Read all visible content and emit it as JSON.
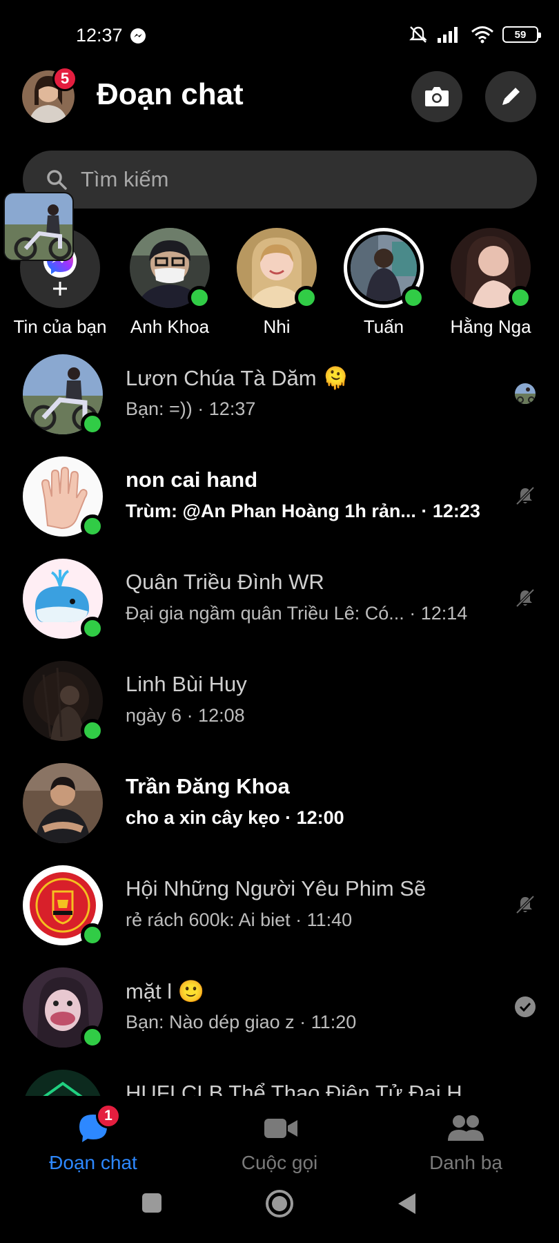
{
  "status_bar": {
    "time": "12:37",
    "battery": "59"
  },
  "header": {
    "title": "Đoạn chat",
    "profile_badge": "5"
  },
  "search": {
    "placeholder": "Tìm kiếm"
  },
  "stories": [
    {
      "label": "Tin của bạn"
    },
    {
      "label": "Anh Khoa"
    },
    {
      "label": "Nhi"
    },
    {
      "label": "Tuấn"
    },
    {
      "label": "Hằng Nga"
    }
  ],
  "chats": [
    {
      "name": "Lươn Chúa Tà Dăm 🫠",
      "preview": "Bạn: =)) · 12:37",
      "status": "seen-avatar"
    },
    {
      "name": "non cai hand",
      "preview": "Trùm: @An Phan Hoàng 1h rản...  · 12:23",
      "status": "muted"
    },
    {
      "name": "Quân Triều Đình WR",
      "preview": "Đại gia ngầm quân Triều Lê: Có...  · 12:14",
      "status": "muted"
    },
    {
      "name": "Linh Bùi Huy",
      "preview": "ngày 6 · 12:08",
      "status": "none"
    },
    {
      "name": "Trần Đăng Khoa",
      "preview": "cho a xin cây kẹo · 12:00",
      "status": "none"
    },
    {
      "name": "Hội Những Người Yêu Phim Sẽ",
      "preview": "rẻ rách 600k: Ai biet · 11:40",
      "status": "muted"
    },
    {
      "name": "mặt l 🙂",
      "preview": "Bạn: Nào dép giao z · 11:20",
      "status": "sent"
    },
    {
      "name": "HUFI CLB Thể Thao Điện Tử Đại H",
      "preview": "",
      "status": "none"
    }
  ],
  "bottom_nav": {
    "chats_label": "Đoạn chat",
    "chats_badge": "1",
    "calls_label": "Cuộc gọi",
    "people_label": "Danh bạ"
  },
  "colors": {
    "accent": "#2d88ff",
    "online": "#31cc46",
    "badge": "#e41e3f"
  }
}
